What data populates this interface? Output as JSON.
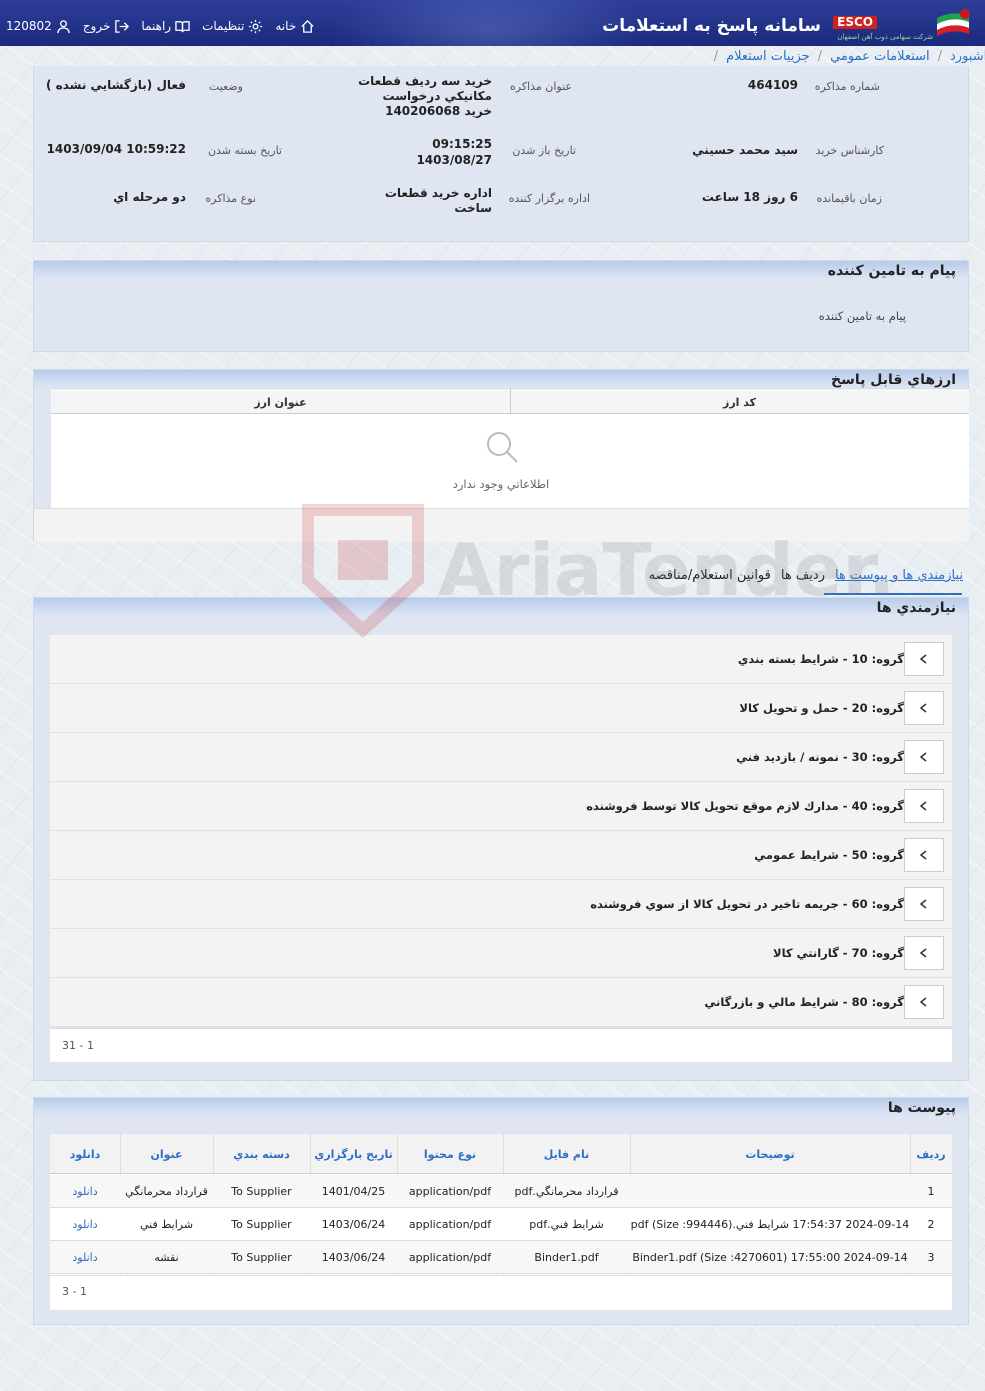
{
  "header": {
    "app_title": "سامانه پاسخ به استعلامات",
    "brand": "ESCO",
    "brand_sub": "شرکت سهامی ذوب آهن اصفهان",
    "nav": {
      "home": "خانه",
      "settings": "تنظیمات",
      "help": "راهنما",
      "logout": "خروج",
      "user_id": "120802"
    }
  },
  "breadcrumb": [
    "داشبورد",
    "استعلامات عمومي",
    "جزييات استعلام"
  ],
  "details": {
    "number_label": "شماره مذاكره",
    "number_value": "464109",
    "title_label": "عنوان مذاكره",
    "title_value": "خريد سه رديف قطعات مكانيكي درخواست خريد 140206068",
    "status_label": "وضعيت",
    "status_value": "فعال (بازگشايي نشده )",
    "expert_label": "كارشناس خريد",
    "expert_value": "سيد محمد حسيني",
    "open_label": "تاريخ باز شدن",
    "open_value_time": "09:15:25",
    "open_value_date": "1403/08/27",
    "close_label": "تاريخ بسته شدن",
    "close_value": "1403/09/04 10:59:22",
    "remaining_label": "زمان باقيمانده",
    "remaining_value": "6 روز 18 ساعت",
    "org_label": "اداره برگزار كننده",
    "org_value": "اداره خريد قطعات ساخت",
    "type_label": "نوع مذاكره",
    "type_value": "دو مرحله اي"
  },
  "supplier_msg": {
    "title": "پيام به تامين كننده",
    "text": "پيام به تامين كننده"
  },
  "currencies": {
    "title": "ارزهاي قابل پاسخ",
    "col_code": "كد ارز",
    "col_title": "عنوان ارز",
    "empty": "اطلاعاتي وجود ندارد"
  },
  "tabs": [
    "نيازمندي ها و پيوست ها",
    "رديف ها",
    "قوانين استعلام/مناقصه"
  ],
  "requirements": {
    "title": "نيازمندي ها",
    "groups": [
      "گروه: 10 - شرايط بسته بندي",
      "گروه: 20 - حمل و تحويل كالا",
      "گروه: 30 - نمونه / بازديد فني",
      "گروه: 40 - مدارك لازم موقع تحويل كالا توسط فروشنده",
      "گروه: 50 - شرايط عمومي",
      "گروه: 60 - جريمه تاخير در تحويل كالا از سوي فروشنده",
      "گروه: 70 - گارانتي كالا",
      "گروه: 80 - شرايط مالي و بازرگاني"
    ],
    "pager": "1 - 31"
  },
  "attachments": {
    "title": "پيوست ها",
    "headers": [
      "رديف",
      "توضيحات",
      "نام فايل",
      "نوع محتوا",
      "تاريخ بارگزاري",
      "دسته بندي",
      "عنوان",
      "دانلود"
    ],
    "rows": [
      [
        "1",
        "",
        "قرارداد محرمانگي.pdf",
        "application/pdf",
        "1401/04/25",
        "To Supplier",
        "قرارداد محرمانگي",
        "دانلود"
      ],
      [
        "2",
        "2024-09-14 17:54:37 شرايط فني.pdf (Size :994446)",
        "شرايط فني.pdf",
        "application/pdf",
        "1403/06/24",
        "To Supplier",
        "شرايط فني",
        "دانلود"
      ],
      [
        "3",
        "2024-09-14 17:55:00 Binder1.pdf (Size :4270601)",
        "Binder1.pdf",
        "application/pdf",
        "1403/06/24",
        "To Supplier",
        "نقشه",
        "دانلود"
      ]
    ],
    "pager": "1 - 3"
  },
  "watermark": "AriaTender.neT"
}
